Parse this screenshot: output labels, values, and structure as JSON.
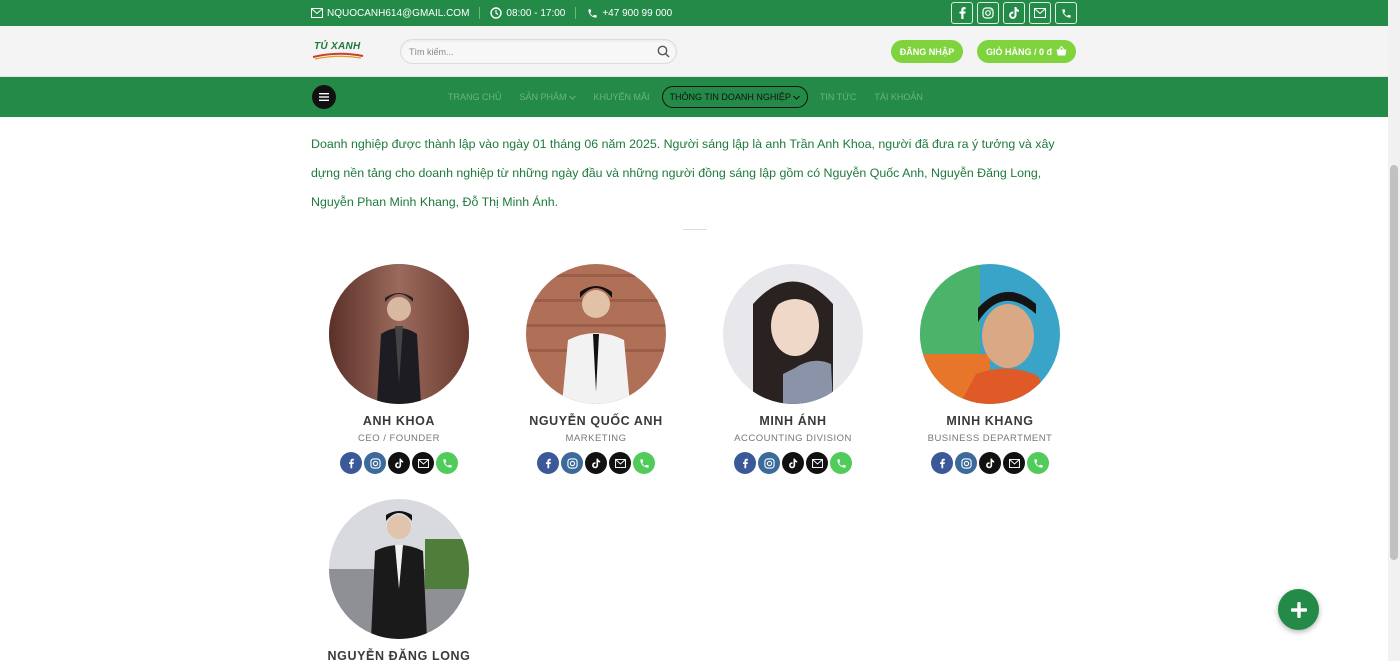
{
  "topbar": {
    "email": "NQUOCANH614@GMAIL.COM",
    "hours": "08:00 - 17:00",
    "phone": "+47 900 99 000",
    "social_icons": [
      "facebook-icon",
      "instagram-icon",
      "tiktok-icon",
      "mail-icon",
      "phone-icon"
    ]
  },
  "header": {
    "logo_text": "TỦ XANH",
    "search_placeholder": "Tìm kiếm...",
    "login_label": "ĐĂNG NHẬP",
    "cart_label": "GIỎ HÀNG / 0 đ"
  },
  "nav": {
    "items": [
      {
        "label": "TRANG CHỦ",
        "dropdown": false
      },
      {
        "label": "SẢN PHẨM",
        "dropdown": true
      },
      {
        "label": "KHUYẾN MÃI",
        "dropdown": false
      },
      {
        "label": "THÔNG TIN DOANH NGHIỆP",
        "dropdown": true,
        "active": true
      },
      {
        "label": "TIN TỨC",
        "dropdown": false
      },
      {
        "label": "TÀI KHOẢN",
        "dropdown": false
      }
    ]
  },
  "intro": "Doanh nghiệp được thành lập vào ngày 01 tháng 06 năm 2025. Người sáng lập là anh Trần Anh Khoa, người đã đưa ra ý tưởng và xây dựng nền tảng cho doanh nghiệp từ những ngày đầu và những người đồng sáng lập gồm có Nguyễn Quốc Anh, Nguyễn Đăng Long, Nguyễn Phan Minh Khang, Đỗ Thị Minh Ánh.",
  "members": [
    {
      "name": "ANH KHOA",
      "role": "CEO / FOUNDER"
    },
    {
      "name": "NGUYỄN QUỐC ANH",
      "role": "MARKETING"
    },
    {
      "name": "MINH ÁNH",
      "role": "ACCOUNTING DIVISION"
    },
    {
      "name": "MINH KHANG",
      "role": "BUSINESS DEPARTMENT"
    },
    {
      "name": "NGUYỄN ĐĂNG LONG",
      "role": ""
    }
  ],
  "colors": {
    "brand_green": "#248a48",
    "accent_lime": "#7fd33d",
    "text_green": "#1e7a3c"
  }
}
